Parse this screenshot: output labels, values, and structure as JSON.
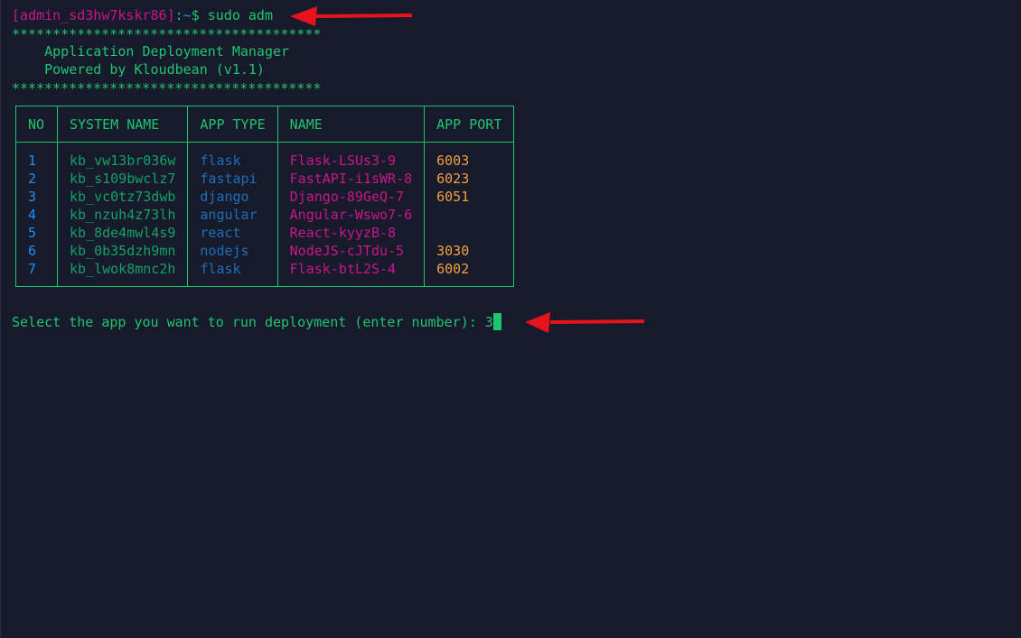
{
  "prompt": {
    "user": "[admin_sd3hw7kskr86]",
    "separator": ":",
    "path": "~",
    "symbol": "$",
    "command": " sudo adm"
  },
  "banner": {
    "stars": "**************************************",
    "title": "    Application Deployment Manager",
    "subtitle": "    Powered by Kloudbean (v1.1)"
  },
  "table": {
    "headers": [
      "NO",
      "SYSTEM NAME",
      "APP TYPE",
      "NAME",
      "APP PORT"
    ],
    "rows": [
      {
        "no": "1",
        "system": "kb_vw13br036w",
        "type": "flask",
        "name": "Flask-LSUs3-9",
        "port": "6003"
      },
      {
        "no": "2",
        "system": "kb_s109bwclz7",
        "type": "fastapi",
        "name": "FastAPI-i1sWR-8",
        "port": "6023"
      },
      {
        "no": "3",
        "system": "kb_vc0tz73dwb",
        "type": "django",
        "name": "Django-89GeQ-7",
        "port": "6051"
      },
      {
        "no": "4",
        "system": "kb_nzuh4z73lh",
        "type": "angular",
        "name": "Angular-Wswo7-6",
        "port": ""
      },
      {
        "no": "5",
        "system": "kb_8de4mwl4s9",
        "type": "react",
        "name": "React-kyyzB-8",
        "port": ""
      },
      {
        "no": "6",
        "system": "kb_0b35dzh9mn",
        "type": "nodejs",
        "name": "NodeJS-cJTdu-5",
        "port": "3030"
      },
      {
        "no": "7",
        "system": "kb_lwok8mnc2h",
        "type": "flask",
        "name": "Flask-btL2S-4",
        "port": "6002"
      }
    ]
  },
  "input_prompt": {
    "text": "Select the app you want to run deployment (enter number): ",
    "value": "3"
  },
  "colors": {
    "background": "#171a2b",
    "green": "#1fc470",
    "magenta": "#c8178a",
    "port": "#f0a040",
    "arrow": "#e8131a"
  }
}
